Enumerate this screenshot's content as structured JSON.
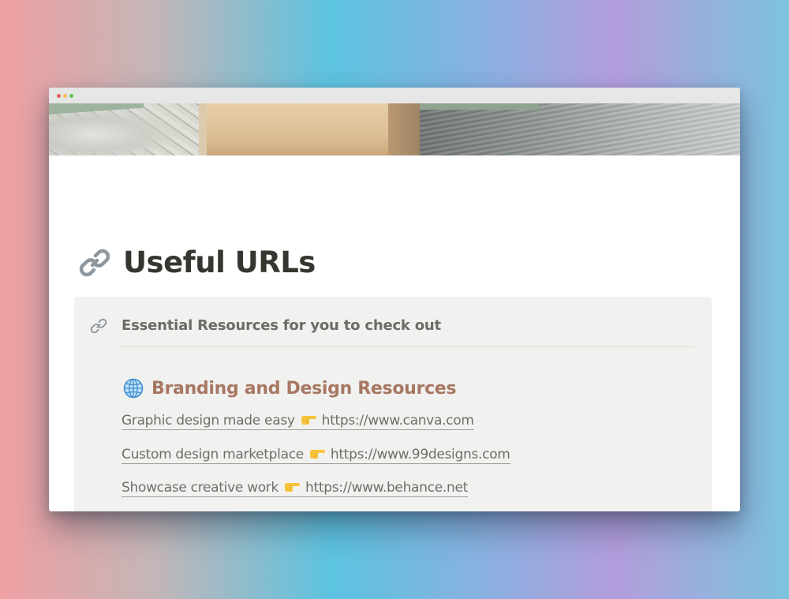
{
  "window": {
    "controls": [
      "close",
      "minimize",
      "maximize"
    ],
    "control_colors": {
      "close": "#ec5f57",
      "minimize": "#f5bf4f",
      "maximize": "#5fc453"
    }
  },
  "page": {
    "title": "Useful URLs",
    "title_icon": "link-icon"
  },
  "callout": {
    "icon": "link-icon",
    "heading": "Essential Resources for you to check out",
    "section": {
      "icon": "globe-icon",
      "title": "Branding and Design Resources",
      "title_color": "#a77763"
    },
    "links": [
      {
        "label": "Graphic design made easy",
        "pointer_icon": "pointing-right-icon",
        "url": "https://www.canva.com"
      },
      {
        "label": "Custom design marketplace",
        "pointer_icon": "pointing-right-icon",
        "url": "https://www.99designs.com"
      },
      {
        "label": "Showcase creative work",
        "pointer_icon": "pointing-right-icon",
        "url": "https://www.behance.net"
      }
    ]
  }
}
